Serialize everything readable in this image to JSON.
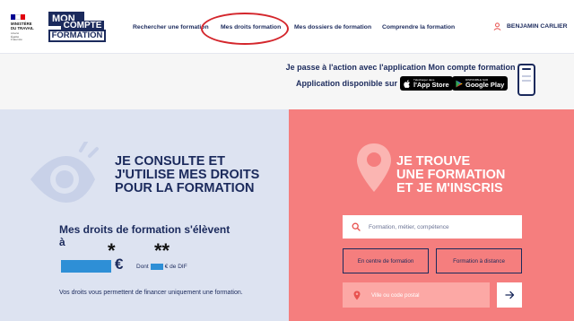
{
  "header": {
    "ministry": "MINISTÈRE\nDU TRAVAIL",
    "motto": "Liberté\nÉgalité\nFraternité",
    "logo": {
      "line1": "MON",
      "line2": "COMPTE",
      "line3": "FORMATION"
    },
    "nav": [
      {
        "label": "Rechercher une formation"
      },
      {
        "label": "Mes droits formation"
      },
      {
        "label": "Mes dossiers de formation"
      },
      {
        "label": "Comprendre la formation"
      }
    ],
    "user_name": "BENJAMIN CARLIER",
    "icons": {
      "user": "user-icon"
    },
    "colors": {
      "navy": "#1b2a5c",
      "highlight": "#d4262c",
      "flag_blue": "#000091",
      "flag_red": "#e1000f"
    }
  },
  "promo": {
    "line1": "Je passe à l'action avec l'application Mon compte formation !",
    "line2": "Application disponible sur",
    "app_store": {
      "small": "Télécharger dans",
      "big": "l'App Store",
      "icon": "apple-icon"
    },
    "google_play": {
      "small": "DISPONIBLE SUR",
      "big": "Google Play",
      "icon": "google-play-icon"
    },
    "phone_icon": "phone-icon"
  },
  "left_panel": {
    "heading": "JE CONSULTE ET\nJ'UTILISE MES DROITS\nPOUR LA FORMATION",
    "rights_title": "Mes droits de formation s'élèvent\nà",
    "asterisk_single": "*",
    "asterisk_double": "**",
    "currency": "€",
    "dont_prefix": "Dont",
    "dont_suffix": "€ de DIF",
    "note": "Vos droits vous permettent de financer uniquement une formation.",
    "icon": "eye-icon",
    "colors": {
      "bg": "#dde3f1",
      "redaction": "#2e8fd6"
    }
  },
  "right_panel": {
    "heading": "JE TROUVE\nUNE FORMATION\nET JE M'INSCRIS",
    "search_placeholder": "Formation, métier, compétence",
    "btn_center": "En centre de formation",
    "btn_distance": "Formation à distance",
    "location_placeholder": "Ville ou code postal",
    "icons": {
      "pin": "map-pin-icon",
      "search": "search-icon",
      "location": "location-icon",
      "arrow": "arrow-right-icon"
    },
    "colors": {
      "bg": "#f57e7e",
      "field_bg": "#fca8a5"
    }
  }
}
